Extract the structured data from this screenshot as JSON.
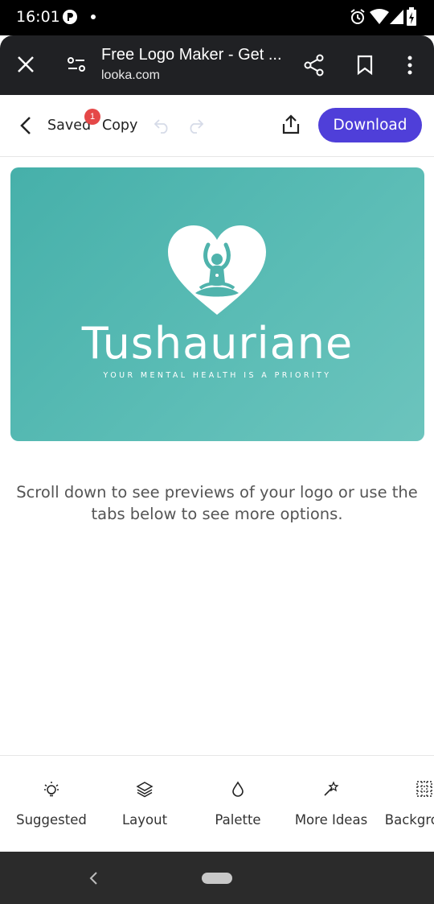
{
  "status_bar": {
    "time": "16:01"
  },
  "browser": {
    "title": "Free Logo Maker - Get ...",
    "url": "looka.com"
  },
  "toolbar": {
    "saved_label": "Saved",
    "badge_count": "1",
    "copy_label": "Copy",
    "download_label": "Download",
    "accent_color": "#4f3fd9"
  },
  "logo": {
    "brand_name": "Tushauriane",
    "tagline": "YOUR MENTAL HEALTH IS A PRIORITY",
    "background_color": "#5ab9b3"
  },
  "helper_text": "Scroll down to see previews of your logo or use the tabs below to see more options.",
  "tabs": [
    {
      "label": "Suggested",
      "icon": "lightbulb-icon"
    },
    {
      "label": "Layout",
      "icon": "layers-icon"
    },
    {
      "label": "Palette",
      "icon": "droplet-icon"
    },
    {
      "label": "More Ideas",
      "icon": "magic-wand-icon"
    },
    {
      "label": "Background",
      "icon": "grid-icon"
    }
  ]
}
